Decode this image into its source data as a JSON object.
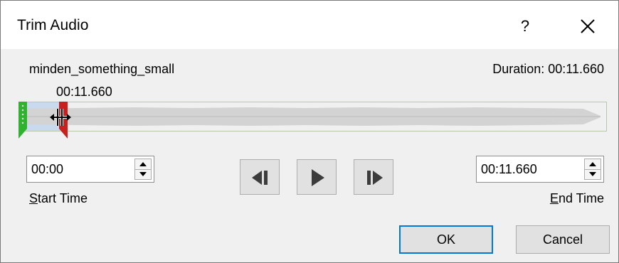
{
  "window": {
    "title": "Trim Audio",
    "help_label": "?",
    "close_icon": "close-icon"
  },
  "audio": {
    "file_name": "minden_something_small",
    "duration_text": "Duration: 00:11.660",
    "end_marker_time": "00:11.660"
  },
  "trim": {
    "start_time": "00:00",
    "end_time": "00:11.660",
    "start_label_prefix": "S",
    "start_label_rest": "tart Time",
    "end_label_prefix": "E",
    "end_label_rest": "nd Time"
  },
  "playback": {
    "buttons": [
      "previous-frame-icon",
      "play-icon",
      "next-frame-icon"
    ]
  },
  "actions": {
    "ok_label": "OK",
    "cancel_label": "Cancel"
  },
  "colors": {
    "selection": "#c9d9ee",
    "start_handle": "#2fb32f",
    "end_handle": "#c81f1f",
    "default_button_border": "#0078d7"
  }
}
